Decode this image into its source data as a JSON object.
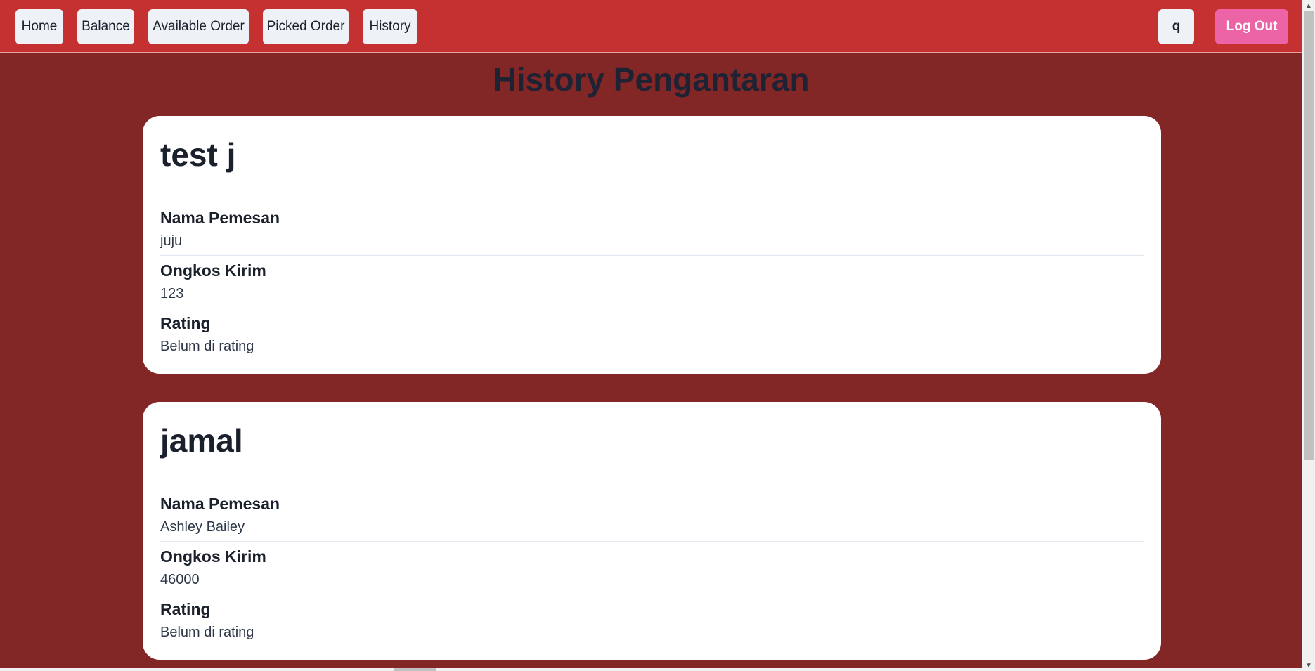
{
  "nav": {
    "items": [
      {
        "label": "Home"
      },
      {
        "label": "Balance"
      },
      {
        "label": "Available Order"
      },
      {
        "label": "Picked Order"
      },
      {
        "label": "History"
      }
    ],
    "user_label": "q",
    "logout_label": "Log Out"
  },
  "page": {
    "title": "History Pengantaran"
  },
  "orders": [
    {
      "title": "test j",
      "customer_label": "Nama Pemesan",
      "customer": "juju",
      "fee_label": "Ongkos Kirim",
      "fee": "123",
      "rating_label": "Rating",
      "rating": "Belum di rating"
    },
    {
      "title": "jamal",
      "customer_label": "Nama Pemesan",
      "customer": "Ashley Bailey",
      "fee_label": "Ongkos Kirim",
      "fee": "46000",
      "rating_label": "Rating",
      "rating": "Belum di rating"
    }
  ],
  "colors": {
    "navbar": "#c53030",
    "background": "#822626",
    "logout": "#ed64a6"
  }
}
